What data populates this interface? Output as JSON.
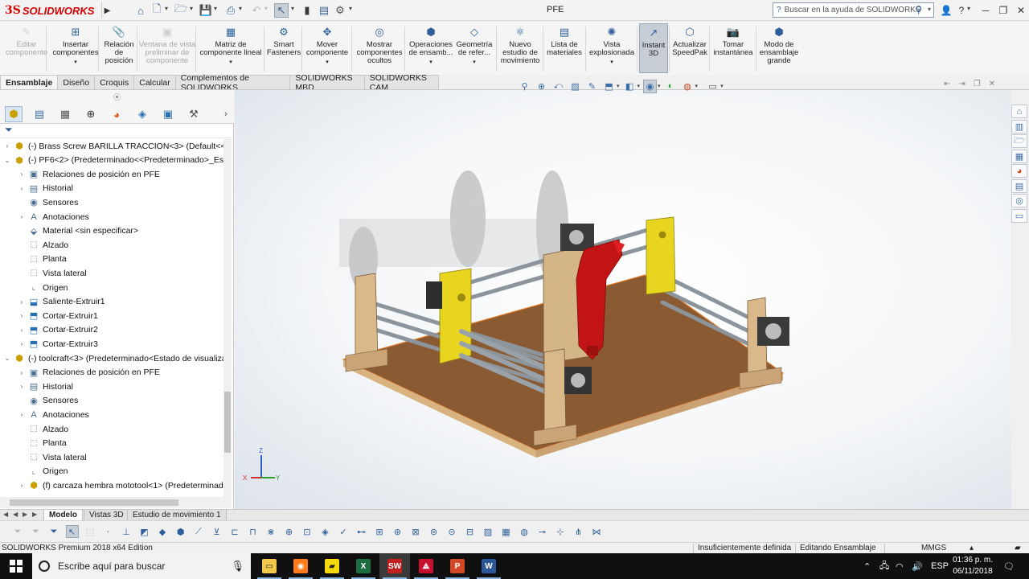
{
  "app": {
    "logo_prefix": "3S",
    "logo_name": "SOLIDWORKS",
    "document_title": "PFE",
    "help_search_placeholder": "Buscar en la ayuda de SOLIDWORKS"
  },
  "commands": [
    {
      "label": "Editar componente",
      "icon": "edit-component-icon",
      "disabled": true
    },
    {
      "label": "Insertar componentes",
      "icon": "insert-component-icon",
      "caret": true
    },
    {
      "label": "Relación de posición",
      "icon": "mate-icon"
    },
    {
      "label": "Ventana de vista preliminar de componente",
      "icon": "preview-window-icon",
      "disabled": true
    },
    {
      "label": "Matriz de componente lineal",
      "icon": "linear-pattern-icon",
      "caret": true
    },
    {
      "label": "Smart Fasteners",
      "icon": "fastener-icon"
    },
    {
      "label": "Mover componente",
      "icon": "move-component-icon",
      "caret": true
    },
    {
      "label": "Mostrar componentes ocultos",
      "icon": "show-hidden-icon"
    },
    {
      "label": "Operaciones de ensamb...",
      "icon": "assembly-features-icon",
      "caret": true
    },
    {
      "label": "Geometría de refer...",
      "icon": "reference-geometry-icon",
      "caret": true
    },
    {
      "label": "Nuevo estudio de movimiento",
      "icon": "motion-study-icon"
    },
    {
      "label": "Lista de materiales",
      "icon": "bom-icon"
    },
    {
      "label": "Vista explosionada",
      "icon": "exploded-view-icon",
      "caret": true
    },
    {
      "label": "Instant 3D",
      "icon": "instant3d-icon",
      "active": true
    },
    {
      "label": "Actualizar SpeedPak",
      "icon": "speedpak-icon"
    },
    {
      "label": "Tomar instantánea",
      "icon": "snapshot-icon"
    },
    {
      "label": "Modo de ensamblaje grande",
      "icon": "large-assembly-icon"
    }
  ],
  "command_tabs": [
    {
      "label": "Ensamblaje",
      "active": true
    },
    {
      "label": "Diseño"
    },
    {
      "label": "Croquis"
    },
    {
      "label": "Calcular"
    },
    {
      "label": "Complementos de SOLIDWORKS"
    },
    {
      "label": "SOLIDWORKS MBD"
    },
    {
      "label": "SOLIDWORKS CAM"
    }
  ],
  "tree": [
    {
      "level": 0,
      "exp": "›",
      "icon": "assembly-icon",
      "label": "(-) Brass Screw BARILLA TRACCION<3> (Default<<Default>"
    },
    {
      "level": 0,
      "exp": "⌄",
      "icon": "assembly-icon",
      "label": "(-) PF6<2> (Predeterminado<<Predeterminado>_Estado"
    },
    {
      "level": 1,
      "exp": "›",
      "icon": "mates-folder-icon",
      "label": "Relaciones de posición en PFE"
    },
    {
      "level": 1,
      "exp": "›",
      "icon": "history-folder-icon",
      "label": "Historial"
    },
    {
      "level": 1,
      "exp": "",
      "icon": "sensors-icon",
      "label": "Sensores"
    },
    {
      "level": 1,
      "exp": "›",
      "icon": "annotations-icon",
      "label": "Anotaciones"
    },
    {
      "level": 1,
      "exp": "",
      "icon": "material-icon",
      "label": "Material <sin especificar>"
    },
    {
      "level": 1,
      "exp": "",
      "icon": "plane-icon",
      "label": "Alzado"
    },
    {
      "level": 1,
      "exp": "",
      "icon": "plane-icon",
      "label": "Planta"
    },
    {
      "level": 1,
      "exp": "",
      "icon": "plane-icon",
      "label": "Vista lateral"
    },
    {
      "level": 1,
      "exp": "",
      "icon": "origin-icon",
      "label": "Origen"
    },
    {
      "level": 1,
      "exp": "›",
      "icon": "extrude-icon",
      "label": "Saliente-Extruir1"
    },
    {
      "level": 1,
      "exp": "›",
      "icon": "cut-extrude-icon",
      "label": "Cortar-Extruir1"
    },
    {
      "level": 1,
      "exp": "›",
      "icon": "cut-extrude-icon",
      "label": "Cortar-Extruir2"
    },
    {
      "level": 1,
      "exp": "›",
      "icon": "cut-extrude-icon",
      "label": "Cortar-Extruir3"
    },
    {
      "level": 0,
      "exp": "⌄",
      "icon": "assembly-icon",
      "label": "(-) toolcraft<3> (Predeterminado<Estado de visualizació"
    },
    {
      "level": 1,
      "exp": "›",
      "icon": "mates-folder-icon",
      "label": "Relaciones de posición en PFE"
    },
    {
      "level": 1,
      "exp": "›",
      "icon": "history-folder-icon",
      "label": "Historial"
    },
    {
      "level": 1,
      "exp": "",
      "icon": "sensors-icon",
      "label": "Sensores"
    },
    {
      "level": 1,
      "exp": "›",
      "icon": "annotations-icon",
      "label": "Anotaciones"
    },
    {
      "level": 1,
      "exp": "",
      "icon": "plane-icon",
      "label": "Alzado"
    },
    {
      "level": 1,
      "exp": "",
      "icon": "plane-icon",
      "label": "Planta"
    },
    {
      "level": 1,
      "exp": "",
      "icon": "plane-icon",
      "label": "Vista lateral"
    },
    {
      "level": 1,
      "exp": "",
      "icon": "origin-icon",
      "label": "Origen"
    },
    {
      "level": 1,
      "exp": "›",
      "icon": "part-icon",
      "label": "(f) carcaza hembra mototool<1> (Predeterminado<"
    }
  ],
  "bottom_tabs": [
    {
      "label": "Modelo",
      "active": true
    },
    {
      "label": "Vistas 3D"
    },
    {
      "label": "Estudio de movimiento 1"
    }
  ],
  "status": {
    "edition": "SOLIDWORKS Premium 2018 x64 Edition",
    "definition": "Insuficientemente definida",
    "mode": "Editando Ensamblaje",
    "units": "MMGS"
  },
  "triad": {
    "x": "X",
    "y": "Y",
    "z": "Z"
  },
  "taskbar": {
    "search_placeholder": "Escribe aquí para buscar",
    "apps": [
      "file-explorer-icon",
      "firefox-icon",
      "sticky-notes-icon",
      "excel-icon",
      "solidworks-icon",
      "acrobat-icon",
      "powerpoint-icon",
      "word-icon"
    ],
    "language": "ESP",
    "time": "01:36 p. m.",
    "date": "06/11/2018"
  }
}
